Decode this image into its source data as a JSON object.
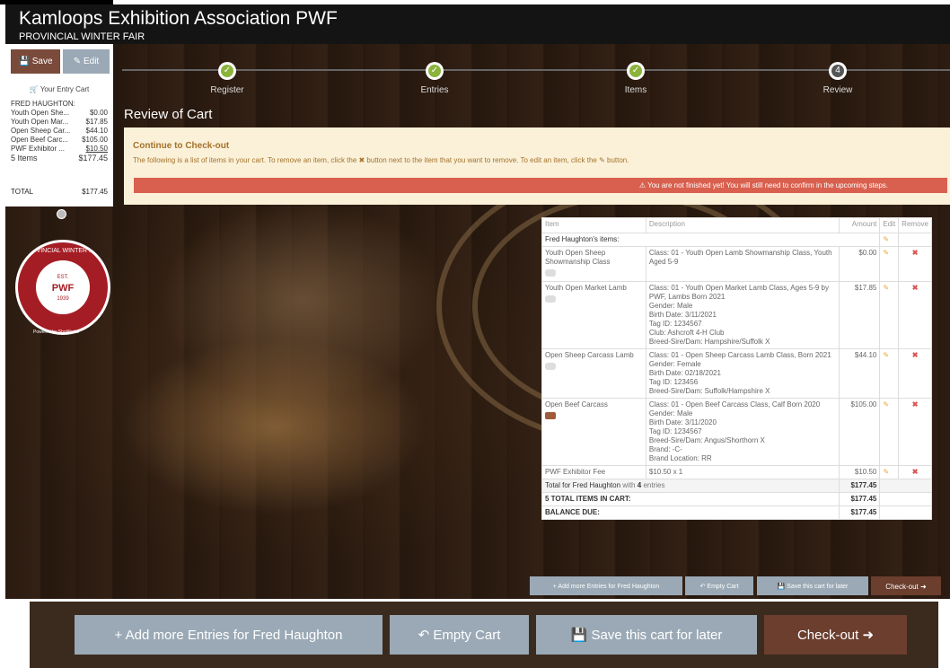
{
  "header": {
    "title": "Kamloops Exhibition Association PWF",
    "subtitle": "PROVINCIAL WINTER FAIR"
  },
  "cart_panel": {
    "save_label": "Save",
    "edit_label": "Edit",
    "heading": "Your Entry Cart",
    "owner": "FRED HAUGHTON:",
    "lines": [
      {
        "name": "Youth Open She...",
        "amount": "$0.00"
      },
      {
        "name": "Youth Open Mar...",
        "amount": "$17.85"
      },
      {
        "name": "Open Sheep Car...",
        "amount": "$44.10"
      },
      {
        "name": "Open Beef Carc...",
        "amount": "$105.00"
      },
      {
        "name": "PWF Exhibitor ...",
        "amount": "$10.50"
      }
    ],
    "count_label": "5 Items",
    "count_total": "$177.45",
    "total_label": "TOTAL",
    "total_value": "$177.45"
  },
  "logo": {
    "arc_text": "PROVINCIAL WINTER FAIR",
    "center": "PWF",
    "est": "EST.",
    "year": "1939",
    "powered": "Powered by ShoWorks"
  },
  "steps": [
    {
      "label": "Register",
      "marker": "✓"
    },
    {
      "label": "Entries",
      "marker": "✓"
    },
    {
      "label": "Items",
      "marker": "✓"
    },
    {
      "label": "Review",
      "marker": "4"
    }
  ],
  "page_title": "Review of Cart",
  "notice": {
    "title": "Continue to Check-out",
    "text": "The following is a list of items in your cart. To remove an item, click the ✖ button next to the item that you want to remove. To edit an item, click the ✎ button.",
    "warning": "⚠ You are not finished yet! You will still need to confirm in the upcoming steps."
  },
  "table": {
    "headers": {
      "item": "Item",
      "description": "Description",
      "amount": "Amount",
      "edit": "Edit",
      "remove": "Remove"
    },
    "owner_row": "Fred Haughton's items:",
    "rows": [
      {
        "item": "Youth Open Sheep Showmanship Class",
        "desc": "Class: 01 - Youth Open Lamb Showmanship Class, Youth Aged 5-9",
        "amount": "$0.00"
      },
      {
        "item": "Youth Open Market Lamb",
        "desc": "Class: 01 - Youth Open Market Lamb Class, Ages 5-9 by PWF, Lambs Born 2021\nGender: Male\nBirth Date: 3/11/2021\nTag ID: 1234567\nClub: Ashcroft 4-H Club\nBreed-Sire/Dam: Hampshire/Suffolk X",
        "amount": "$17.85"
      },
      {
        "item": "Open Sheep Carcass Lamb",
        "desc": "Class: 01 - Open Sheep Carcass Lamb Class, Born 2021\nGender: Female\nBirth Date: 02/18/2021\nTag ID: 123456\nBreed-Sire/Dam: Suffolk/Hampshire X",
        "amount": "$44.10"
      },
      {
        "item": "Open Beef Carcass",
        "desc": "Class: 01 - Open Beef Carcass Class, Calf Born 2020\nGender: Male\nBirth Date: 3/11/2020\nTag ID: 1234567\nBreed-Sire/Dam: Angus/Shorthorn X\nBrand: -C-\nBrand Location: RR",
        "amount": "$105.00"
      },
      {
        "item": "PWF Exhibitor Fee",
        "desc": "$10.50 x 1",
        "amount": "$10.50"
      }
    ],
    "total_for_label": "Total for Fred Haughton",
    "total_for_with": "with",
    "total_for_entries": "4",
    "total_for_entries_word": "entries",
    "total_for_value": "$177.45",
    "total_items_label": "5 TOTAL ITEMS IN CART:",
    "total_items_value": "$177.45",
    "balance_label": "BALANCE DUE:",
    "balance_value": "$177.45"
  },
  "actions": {
    "add": "Add more Entries for Fred Haughton",
    "empty": "Empty Cart",
    "save": "Save this cart for later",
    "checkout": "Check-out"
  },
  "colors": {
    "brown": "#7a4a3a",
    "slate": "#9aa9b5",
    "green": "#8bb33c",
    "warn": "#d9604e",
    "notice": "#fbf1d9"
  }
}
